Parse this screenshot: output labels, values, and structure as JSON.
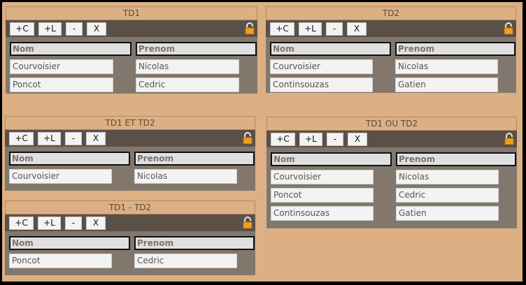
{
  "buttons": {
    "add_col": "+C",
    "add_line": "+L",
    "remove": "-",
    "delete": "X"
  },
  "columns": {
    "nom": "Nom",
    "prenom": "Prenom"
  },
  "panels": {
    "td1": {
      "title": "TD1",
      "rows": [
        {
          "nom": "Courvoisier",
          "prenom": "Nicolas"
        },
        {
          "nom": "Poncot",
          "prenom": "Cedric"
        }
      ]
    },
    "td2": {
      "title": "TD2",
      "rows": [
        {
          "nom": "Courvoisier",
          "prenom": "Nicolas"
        },
        {
          "nom": "Continsouzas",
          "prenom": "Gatien"
        }
      ]
    },
    "td1_et_td2": {
      "title": "TD1 ET TD2",
      "rows": [
        {
          "nom": "Courvoisier",
          "prenom": "Nicolas"
        }
      ]
    },
    "td1_ou_td2": {
      "title": "TD1 OU TD2",
      "rows": [
        {
          "nom": "Courvoisier",
          "prenom": "Nicolas"
        },
        {
          "nom": "Poncot",
          "prenom": "Cedric"
        },
        {
          "nom": "Continsouzas",
          "prenom": "Gatien"
        }
      ]
    },
    "td1_moins_td2": {
      "title": "TD1 - TD2",
      "rows": [
        {
          "nom": "Poncot",
          "prenom": "Cedric"
        }
      ]
    }
  },
  "icons": {
    "lock": "lock-open-icon"
  },
  "colors": {
    "background": "#dcb084",
    "toolbar": "#5b5048",
    "table_body": "#82776d",
    "lock": "#f0a020"
  }
}
